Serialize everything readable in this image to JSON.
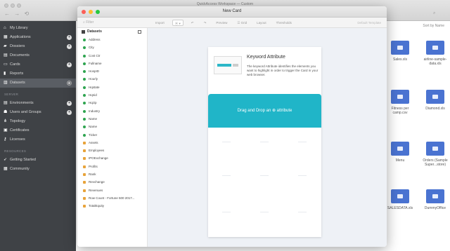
{
  "background": {
    "window_title": "QuickAccess Workspace — Custom",
    "nav_glyphs": "← → ⟲",
    "search_glyph": "⌕",
    "breadcrumb": "Sort by Name",
    "sidebar": {
      "top_items": [
        {
          "label": "My Library",
          "icon": "home-icon"
        },
        {
          "label": "Applications",
          "icon": "grid-icon",
          "badge": "+"
        },
        {
          "label": "Dossiers",
          "icon": "folder-icon",
          "badge": "+"
        },
        {
          "label": "Documents",
          "icon": "doc-icon"
        },
        {
          "label": "Cards",
          "icon": "card-icon",
          "badge": "+"
        },
        {
          "label": "Reports",
          "icon": "report-icon"
        },
        {
          "label": "Datasets",
          "icon": "dataset-icon",
          "selected": true,
          "badge": "⊕"
        }
      ],
      "section1_header": "SERVER",
      "section1_items": [
        {
          "label": "Environments",
          "icon": "server-icon",
          "badge": "+"
        },
        {
          "label": "Users and Groups",
          "icon": "users-icon",
          "badge": "+"
        },
        {
          "label": "Topology",
          "icon": "topology-icon"
        },
        {
          "label": "Certificates",
          "icon": "cert-icon"
        },
        {
          "label": "Licenses",
          "icon": "key-icon"
        }
      ],
      "section2_header": "RESOURCES",
      "section2_items": [
        {
          "label": "Getting Started",
          "icon": "rocket-icon"
        },
        {
          "label": "Community",
          "icon": "community-icon"
        }
      ]
    },
    "files": [
      {
        "name": "Sales.xls",
        "name2": ""
      },
      {
        "name": "airline-sample-",
        "name2": "data.xls"
      },
      {
        "name": "Fitness per",
        "name2": "camp.csv"
      },
      {
        "name": "Diamond.xls",
        "name2": ""
      },
      {
        "name": "Menu",
        "name2": ""
      },
      {
        "name": "Orders (Sample",
        "name2": "Super...store)"
      },
      {
        "name": "SALESDATA.xls",
        "name2": ""
      },
      {
        "name": "DummyOffice",
        "name2": ""
      }
    ]
  },
  "modal": {
    "title": "New Card",
    "toolbar": {
      "search_placeholder": "⌕ Filter",
      "buttons": [
        "Import",
        "⦿ ▾",
        "↶",
        "↷",
        "Preview",
        "☰ Grid",
        "Layout",
        "Thresholds"
      ],
      "right_label": "Default Template"
    },
    "left_panel": {
      "header": "Datasets",
      "attributes": [
        "Address",
        "City",
        "Cost Ctr",
        "Fullname",
        "HospID",
        "Hourly",
        "Hqstate",
        "Hqnid",
        "Hqzip",
        "Industry",
        "Name",
        "Name",
        "Ticker"
      ],
      "relations": [
        "Assets",
        "Employees",
        "IPOExchange",
        "Profits",
        "Rank",
        "Revchange",
        "Revenues",
        "Row Count - Fortune 500 2017...",
        "TotalEquity"
      ]
    },
    "card": {
      "title": "Keyword Attribute",
      "description": "The keyword Attribute identifies the elements you want to highlight in order to trigger the Card in your web browser.",
      "drop_label": "Drag and Drop an ⊕ attribute"
    }
  }
}
